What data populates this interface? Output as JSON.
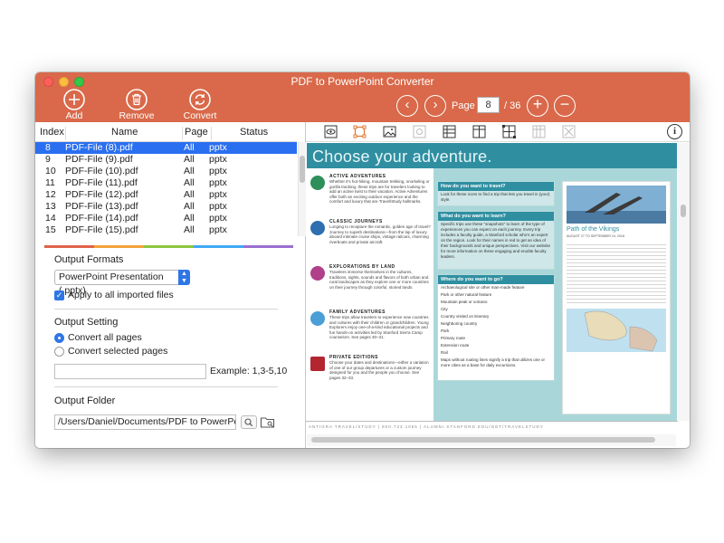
{
  "window": {
    "title": "PDF to PowerPoint Converter"
  },
  "toolbar": {
    "add_label": "Add",
    "remove_label": "Remove",
    "convert_label": "Convert",
    "page_label": "Page",
    "page_current": "8",
    "page_total": "/ 36",
    "prev_icon": "chevron-left-icon",
    "next_icon": "chevron-right-icon",
    "zoom_in_icon": "plus-icon",
    "zoom_out_icon": "minus-icon"
  },
  "file_table": {
    "headers": {
      "index": "Index",
      "name": "Name",
      "page": "Page",
      "status": "Status"
    },
    "rows": [
      {
        "index": "8",
        "name": "PDF-File (8).pdf",
        "page": "All",
        "status": "pptx"
      },
      {
        "index": "9",
        "name": "PDF-File (9).pdf",
        "page": "All",
        "status": "pptx"
      },
      {
        "index": "10",
        "name": "PDF-File (10).pdf",
        "page": "All",
        "status": "pptx"
      },
      {
        "index": "11",
        "name": "PDF-File (11).pdf",
        "page": "All",
        "status": "pptx"
      },
      {
        "index": "12",
        "name": "PDF-File (12).pdf",
        "page": "All",
        "status": "pptx"
      },
      {
        "index": "13",
        "name": "PDF-File (13).pdf",
        "page": "All",
        "status": "pptx"
      },
      {
        "index": "14",
        "name": "PDF-File (14).pdf",
        "page": "All",
        "status": "pptx"
      },
      {
        "index": "15",
        "name": "PDF-File (15).pdf",
        "page": "All",
        "status": "pptx"
      }
    ]
  },
  "settings": {
    "output_formats_label": "Output Formats",
    "format_value": "PowerPoint Presentation (.pptx)",
    "apply_all_label": "Apply to all imported files",
    "output_setting_label": "Output Setting",
    "convert_all_label": "Convert all pages",
    "convert_selected_label": "Convert selected pages",
    "pages_input_value": "",
    "example_label": "Example: 1,3-5,10",
    "output_folder_label": "Output Folder",
    "folder_path": "/Users/Daniel/Documents/PDF to PowerPoint Conver"
  },
  "preview": {
    "page_title": "Choose your adventure.",
    "sections": [
      {
        "head": "ACTIVE ADVENTURES",
        "text": "Whether it's hot-hiking, mountain trekking, snorkeling or gorilla tracking, these trips are for travelers looking to add an active twist to their vacation. Active Adventures offer both an exciting outdoor experience and the comfort and luxury that are Travel/Study hallmarks."
      },
      {
        "head": "CLASSIC JOURNEYS",
        "text": "Longing to recapture the romantic, golden age of travel? Journey to superb destinations—from the lap of luxury aboard intimate cruise ships, vintage railcars, charming riverboats and private aircraft."
      },
      {
        "head": "EXPLORATIONS BY LAND",
        "text": "Travelers immerse themselves in the cultures, traditions, sights, sounds and flavors of both urban and rural landscapes as they explore one or more countries on their journey through colorful, storied lands."
      },
      {
        "head": "FAMILY ADVENTURES",
        "text": "These trips allow travelers to experience new countries and cultures with their children or grandchildren. Young Explorers enjoy one-of-a-kind educational projects and fun hands-on activities led by Stanford Sierra Camp counselors. See pages 30–31."
      },
      {
        "head": "PRIVATE EDITIONS",
        "text": "Choose your dates and destinations—either a variation of one of our group departures or a custom journey designed for you and the people you choose. See pages 32–33."
      }
    ],
    "boxes": [
      {
        "head": "How do you want to travel?",
        "text": "Look for these icons to find a trip that lets you travel in (your) style."
      },
      {
        "head": "What do you want to learn?",
        "text": "Specific trips use these \"snapshots\" to learn of the type of experiences you can expect on each journey. Every trip includes a faculty guide, a Stanford scholar who's an expert on the region. Look for their names in red to get an idea of their backgrounds and unique perspectives. Visit our website for more information on these engaging and erudite faculty leaders."
      },
      {
        "head": "Where do you want to go?",
        "text": "Maps without routing lines signify a trip that utilizes one or more cities as a base for daily excursions."
      }
    ],
    "legend": [
      "Archaeological site or other man-made feature",
      "Park or other natural feature",
      "Mountain peak or volcano",
      "City",
      "Country visited on itinerary",
      "Neighboring country",
      "Park",
      "Primary route",
      "Extension route",
      "Rail"
    ],
    "sidebar_title": "Path of the Vikings",
    "sidebar_date": "AUGUST 27 TO SEPTEMBER 10, 2018",
    "footer": "ANTIGRA TRAVEL/STUDY | 800.723.1065 | ALUMNI.STANFORD.EDU/GET/TRAVELSTUDY"
  },
  "colors": {
    "accent": "#d9694a",
    "selection": "#2a6ff0",
    "teal": "#2f8fa1"
  }
}
